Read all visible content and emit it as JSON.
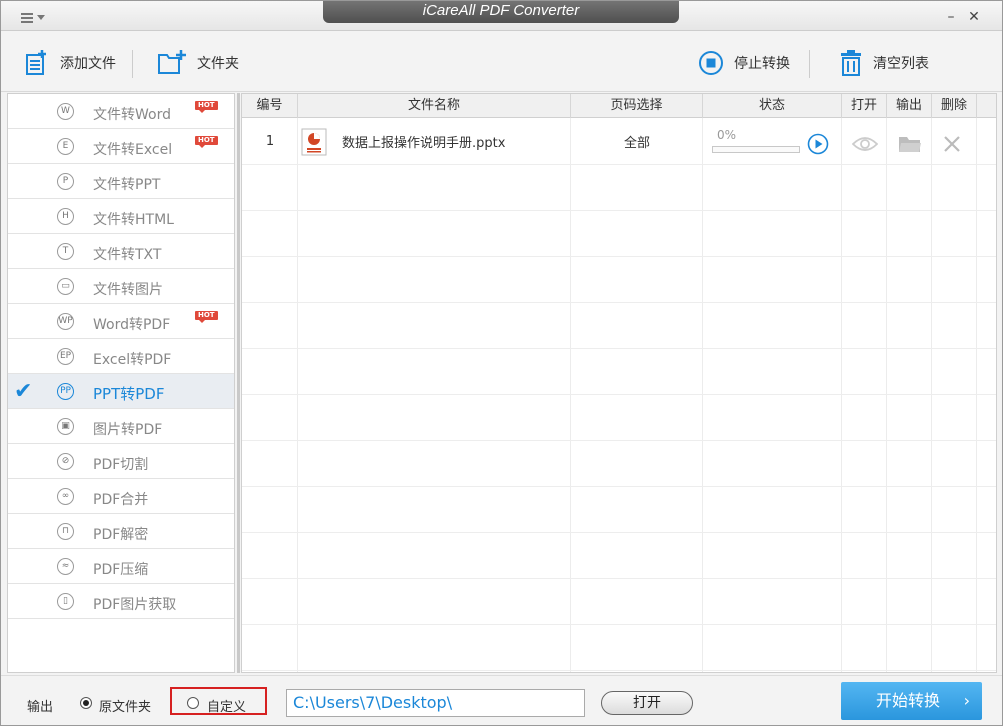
{
  "window": {
    "title": "iCareAll PDF Converter"
  },
  "toolbar": {
    "add_file": "添加文件",
    "add_folder": "文件夹",
    "stop": "停止转换",
    "clear": "清空列表"
  },
  "sidebar": {
    "items": [
      {
        "label": "文件转Word",
        "glyph": "W",
        "hot": "HOT"
      },
      {
        "label": "文件转Excel",
        "glyph": "E",
        "hot": "HOT"
      },
      {
        "label": "文件转PPT",
        "glyph": "P"
      },
      {
        "label": "文件转HTML",
        "glyph": "H"
      },
      {
        "label": "文件转TXT",
        "glyph": "T"
      },
      {
        "label": "文件转图片",
        "glyph": "▭"
      },
      {
        "label": "Word转PDF",
        "glyph": "WP",
        "hot": "HOT"
      },
      {
        "label": "Excel转PDF",
        "glyph": "EP"
      },
      {
        "label": "PPT转PDF",
        "glyph": "PP",
        "active": true
      },
      {
        "label": "图片转PDF",
        "glyph": "▣"
      },
      {
        "label": "PDF切割",
        "glyph": "⊘"
      },
      {
        "label": "PDF合并",
        "glyph": "∞"
      },
      {
        "label": "PDF解密",
        "glyph": "⊓"
      },
      {
        "label": "PDF压缩",
        "glyph": "≈"
      },
      {
        "label": "PDF图片获取",
        "glyph": "▯"
      }
    ]
  },
  "table": {
    "headers": {
      "index": "编号",
      "name": "文件名称",
      "pages": "页码选择",
      "status": "状态",
      "open": "打开",
      "output": "输出",
      "delete": "删除"
    },
    "rows": [
      {
        "index": "1",
        "name": "数据上报操作说明手册.pptx",
        "pages": "全部",
        "progress_text": "0%",
        "progress": 0
      }
    ]
  },
  "bottom": {
    "output_label": "输出",
    "opt_source": "原文件夹",
    "opt_custom": "自定义",
    "path": "C:\\Users\\7\\Desktop\\",
    "open": "打开",
    "start": "开始转换"
  },
  "colors": {
    "accent": "#1b87d8",
    "hot": "#e0493a",
    "highlight_border": "#d62020"
  }
}
